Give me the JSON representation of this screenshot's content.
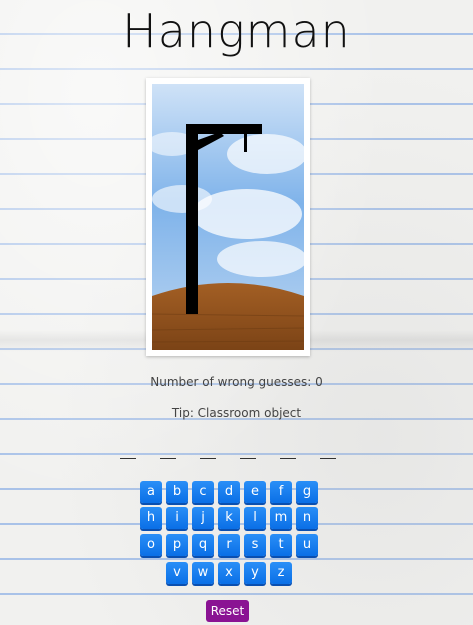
{
  "title": "Hangman",
  "wrong_guesses_text": "Number of wrong guesses: 0",
  "tip_text": "Tip: Classroom object",
  "blanks": [
    "_",
    "_",
    "_",
    "_",
    "_",
    "_"
  ],
  "keyboard": {
    "row1": [
      "a",
      "b",
      "c",
      "d",
      "e",
      "f",
      "g"
    ],
    "row2": [
      "h",
      "i",
      "j",
      "k",
      "l",
      "m",
      "n"
    ],
    "row3": [
      "o",
      "p",
      "q",
      "r",
      "s",
      "t",
      "u"
    ],
    "row4": [
      "v",
      "w",
      "x",
      "y",
      "z"
    ]
  },
  "reset_label": "Reset",
  "colors": {
    "key": "#1a7ff0",
    "reset": "#8a1393",
    "paper_line": "#a9c2e8"
  }
}
